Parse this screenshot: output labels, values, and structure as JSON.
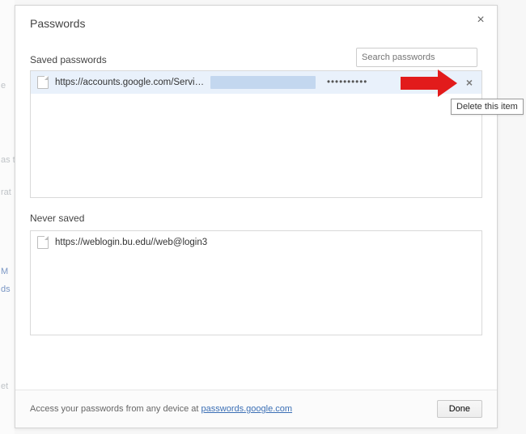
{
  "dialog": {
    "title": "Passwords",
    "saved_label": "Saved passwords",
    "never_label": "Never saved",
    "search_placeholder": "Search passwords",
    "footer_text": "Access your passwords from any device at ",
    "footer_link": "passwords.google.com",
    "done_label": "Done"
  },
  "saved_rows": [
    {
      "site": "https://accounts.google.com/Servic…",
      "password_mask": "••••••••••"
    }
  ],
  "never_rows": [
    {
      "site": "https://weblogin.bu.edu//web@login3"
    }
  ],
  "tooltip": "Delete this item",
  "bg_fragments": [
    "e",
    "as t",
    "rat",
    "M",
    "ds",
    "et"
  ]
}
